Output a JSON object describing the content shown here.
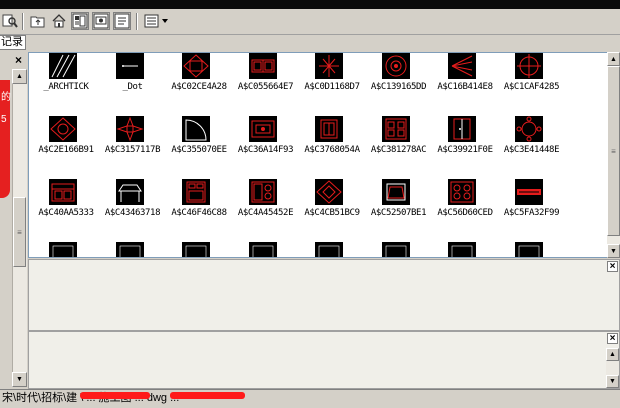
{
  "window": {
    "tab_label": "记录"
  },
  "toolbar": {
    "buttons": [
      {
        "name": "search-icon"
      },
      {
        "name": "folder-up-icon"
      },
      {
        "name": "home-icon"
      },
      {
        "name": "tree-view-icon"
      },
      {
        "name": "preview-icon"
      },
      {
        "name": "description-icon"
      },
      {
        "name": "views-icon"
      }
    ]
  },
  "left_panel": {
    "close_glyph": "×",
    "side_text": [
      "的",
      "5"
    ]
  },
  "colors": {
    "thumb_bg": "#000000",
    "thumb_stroke": "#e51c1c",
    "dot_stroke": "#ffffff",
    "accent_red": "#ff1a1a"
  },
  "blocks": [
    {
      "label": "_ARCHTICK",
      "icon": "hatch-lines"
    },
    {
      "label": "_Dot",
      "icon": "dot-line"
    },
    {
      "label": "A$C02CE4A28",
      "icon": "octagon-diamond"
    },
    {
      "label": "A$C055664E7",
      "icon": "double-window"
    },
    {
      "label": "A$C0D1168D7",
      "icon": "tree-cross"
    },
    {
      "label": "A$C139165DD",
      "icon": "gear-circle"
    },
    {
      "label": "A$C16B414E8",
      "icon": "fan-rays"
    },
    {
      "label": "A$C1CAF4285",
      "icon": "crosshair-circle"
    },
    {
      "label": "A$C2E166B91",
      "icon": "diamond-table"
    },
    {
      "label": "A$C3157117B",
      "icon": "star-cross"
    },
    {
      "label": "A$C355070EE",
      "icon": "quarter-arc"
    },
    {
      "label": "A$C36A14F93",
      "icon": "sofa-plan"
    },
    {
      "label": "A$C3768054A",
      "icon": "chair-plan"
    },
    {
      "label": "A$C381278AC",
      "icon": "pattern-square"
    },
    {
      "label": "A$C39921F0E",
      "icon": "door-plan"
    },
    {
      "label": "A$C3E41448E",
      "icon": "round-table"
    },
    {
      "label": "A$C40AA5333",
      "icon": "cabinet-plan"
    },
    {
      "label": "A$C43463718",
      "icon": "desk-perspective"
    },
    {
      "label": "A$C46F46C88",
      "icon": "bed-plan"
    },
    {
      "label": "A$C4A45452E",
      "icon": "kitchen-plan"
    },
    {
      "label": "A$C4CB51BC9",
      "icon": "diamond-room"
    },
    {
      "label": "A$C52507BE1",
      "icon": "tilted-square"
    },
    {
      "label": "A$C56D60CED",
      "icon": "stove-burners"
    },
    {
      "label": "A$C5FA32F99",
      "icon": "text-bar"
    },
    {
      "label": "",
      "icon": "partial"
    },
    {
      "label": "",
      "icon": "partial"
    },
    {
      "label": "",
      "icon": "partial"
    },
    {
      "label": "",
      "icon": "partial"
    },
    {
      "label": "",
      "icon": "partial"
    },
    {
      "label": "",
      "icon": "partial"
    },
    {
      "label": "",
      "icon": "partial"
    },
    {
      "label": "",
      "icon": "partial"
    }
  ],
  "panels": {
    "preview_close": "×",
    "description_close": "×"
  },
  "status": {
    "text": "宋\\时代\\招标\\建    \\ ... 施工图 ... dwg ... "
  }
}
